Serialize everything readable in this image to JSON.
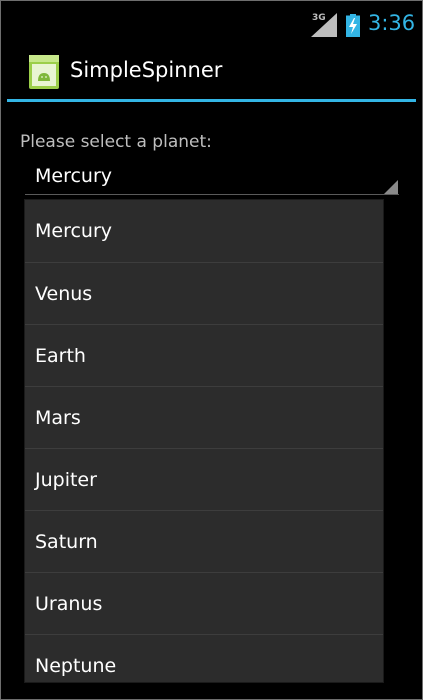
{
  "status_bar": {
    "network": "3G",
    "time": "3:36",
    "signal_icon": "signal-icon",
    "battery_icon": "battery-charging-icon",
    "clock_color": "#33b5e5"
  },
  "action_bar": {
    "title": "SimpleSpinner",
    "app_icon": "android-app-icon",
    "accent_color": "#33b5e5"
  },
  "content": {
    "prompt": "Please select a planet:",
    "spinner": {
      "selected": "Mercury",
      "arrow_icon": "dropdown-arrow-icon"
    }
  },
  "dropdown": {
    "items": [
      {
        "label": "Mercury"
      },
      {
        "label": "Venus"
      },
      {
        "label": "Earth"
      },
      {
        "label": "Mars"
      },
      {
        "label": "Jupiter"
      },
      {
        "label": "Saturn"
      },
      {
        "label": "Uranus"
      },
      {
        "label": "Neptune"
      }
    ]
  }
}
